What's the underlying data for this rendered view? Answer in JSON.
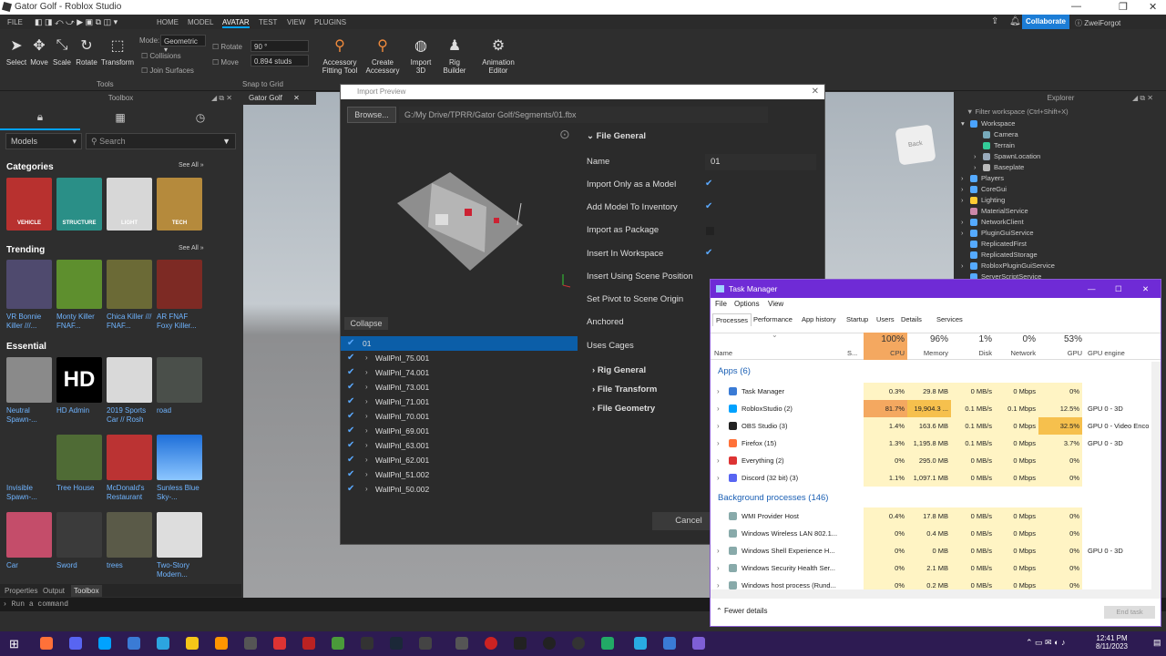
{
  "window": {
    "title": "Gator Golf - Roblox Studio"
  },
  "menubar": {
    "items": [
      "FILE",
      "HOME",
      "MODEL",
      "AVATAR",
      "TEST",
      "VIEW",
      "PLUGINS"
    ],
    "active": "AVATAR",
    "collaborate": "Collaborate",
    "user": "ZweiForgot"
  },
  "ribbon": {
    "tools": [
      "Select",
      "Move",
      "Scale",
      "Rotate",
      "Transform"
    ],
    "tools_group": "Tools",
    "mode_label": "Mode:",
    "mode_value": "Geometric",
    "collisions": "Collisions",
    "join_surfaces": "Join Surfaces",
    "rotate_label": "Rotate",
    "rotate_value": "90 °",
    "move_label": "Move",
    "move_value": "0.894 studs",
    "snap_group": "Snap to Grid",
    "avatar_tools": [
      {
        "label1": "Accessory",
        "label2": "Fitting Tool"
      },
      {
        "label1": "Create",
        "label2": "Accessory"
      },
      {
        "label1": "Import",
        "label2": "3D"
      },
      {
        "label1": "Rig",
        "label2": "Builder"
      },
      {
        "label1": "Animation",
        "label2": "Editor"
      }
    ]
  },
  "toolbox": {
    "title": "Toolbox",
    "filter": "Models",
    "search_placeholder": "Search",
    "categories_title": "Categories",
    "see_all": "See All »",
    "categories": [
      "VEHICLE",
      "STRUCTURE",
      "LIGHT",
      "TECH"
    ],
    "trending_title": "Trending",
    "trending": [
      "VR Bonnie Killer ///...",
      "Monty Killer FNAF...",
      "Chica Killer /// FNAF...",
      "AR FNAF Foxy Killer..."
    ],
    "essential_title": "Essential",
    "essential": [
      "Neutral Spawn-...",
      "HD Admin",
      "2019 Sports Car // Rosh",
      "road",
      "Invisible Spawn-...",
      "Tree House",
      "McDonald's Restaurant",
      "Sunless Blue Sky-...",
      "Car",
      "Sword",
      "trees",
      "Two-Story Modern..."
    ],
    "hd_badge": "HD"
  },
  "bottom_tabs": [
    "Properties",
    "Output",
    "Toolbox"
  ],
  "command_placeholder": "Run a command",
  "viewport": {
    "tab": "Gator Golf",
    "cube_label": "Back"
  },
  "import": {
    "title": "Import Preview",
    "browse": "Browse...",
    "path": "G:/My Drive/TPRR/Gator Golf/Segments/01.fbx",
    "collapse": "Collapse",
    "tree_root": "01",
    "tree_items": [
      "WallPnl_75.001",
      "WallPnl_74.001",
      "WallPnl_73.001",
      "WallPnl_71.001",
      "WallPnl_70.001",
      "WallPnl_69.001",
      "WallPnl_63.001",
      "WallPnl_62.001",
      "WallPnl_51.002",
      "WallPnl_50.002"
    ],
    "section_general": "File General",
    "name_label": "Name",
    "name_value": "01",
    "props": [
      {
        "label": "Import Only as a Model",
        "checked": true
      },
      {
        "label": "Add Model To Inventory",
        "checked": true
      },
      {
        "label": "Import as Package",
        "checked": false
      },
      {
        "label": "Insert In Workspace",
        "checked": true
      },
      {
        "label": "Insert Using Scene Position",
        "checked": false
      },
      {
        "label": "Set Pivot to Scene Origin",
        "checked": false
      },
      {
        "label": "Anchored",
        "checked": false
      },
      {
        "label": "Uses Cages",
        "checked": false
      }
    ],
    "sections": [
      "Rig General",
      "File Transform",
      "File Geometry"
    ],
    "cancel": "Cancel"
  },
  "explorer": {
    "title": "Explorer",
    "filter": "Filter workspace (Ctrl+Shift+X)",
    "items": [
      {
        "name": "Workspace",
        "indent": 0,
        "color": "#4aa3ff",
        "arrow": "▾"
      },
      {
        "name": "Camera",
        "indent": 1,
        "color": "#7ab",
        "arrow": ""
      },
      {
        "name": "Terrain",
        "indent": 1,
        "color": "#3c9",
        "arrow": ""
      },
      {
        "name": "SpawnLocation",
        "indent": 1,
        "color": "#9ab",
        "arrow": "›"
      },
      {
        "name": "Baseplate",
        "indent": 1,
        "color": "#bbb",
        "arrow": "›"
      },
      {
        "name": "Players",
        "indent": 0,
        "color": "#5af",
        "arrow": "›"
      },
      {
        "name": "CoreGui",
        "indent": 0,
        "color": "#5af",
        "arrow": "›"
      },
      {
        "name": "Lighting",
        "indent": 0,
        "color": "#fc3",
        "arrow": "›"
      },
      {
        "name": "MaterialService",
        "indent": 0,
        "color": "#c8a",
        "arrow": ""
      },
      {
        "name": "NetworkClient",
        "indent": 0,
        "color": "#5af",
        "arrow": "›"
      },
      {
        "name": "PluginGuiService",
        "indent": 0,
        "color": "#5af",
        "arrow": "›"
      },
      {
        "name": "ReplicatedFirst",
        "indent": 0,
        "color": "#5af",
        "arrow": ""
      },
      {
        "name": "ReplicatedStorage",
        "indent": 0,
        "color": "#5af",
        "arrow": ""
      },
      {
        "name": "RobloxPluginGuiService",
        "indent": 0,
        "color": "#5af",
        "arrow": "›"
      },
      {
        "name": "ServerScriptService",
        "indent": 0,
        "color": "#5af",
        "arrow": ""
      }
    ]
  },
  "taskmgr": {
    "title": "Task Manager",
    "menu": [
      "File",
      "Options",
      "View"
    ],
    "tabs": [
      "Processes",
      "Performance",
      "App history",
      "Startup",
      "Users",
      "Details",
      "Services"
    ],
    "columns": {
      "name": "Name",
      "status": "S...",
      "cpu_pct": "100%",
      "cpu": "CPU",
      "mem_pct": "96%",
      "mem": "Memory",
      "disk_pct": "1%",
      "disk": "Disk",
      "net_pct": "0%",
      "net": "Network",
      "gpu_pct": "53%",
      "gpu": "GPU",
      "gpu_engine": "GPU engine"
    },
    "apps_title": "Apps (6)",
    "apps": [
      {
        "name": "Task Manager",
        "cpu": "0.3%",
        "mem": "29.8 MB",
        "disk": "0 MB/s",
        "net": "0 Mbps",
        "gpu": "0%",
        "engine": "",
        "icon": "#3a7bd5"
      },
      {
        "name": "RobloxStudio (2)",
        "cpu": "81.7%",
        "mem": "19,904.3 ...",
        "disk": "0.1 MB/s",
        "net": "0.1 Mbps",
        "gpu": "12.5%",
        "engine": "GPU 0 - 3D",
        "icon": "#00a2ff"
      },
      {
        "name": "OBS Studio (3)",
        "cpu": "1.4%",
        "mem": "163.6 MB",
        "disk": "0.1 MB/s",
        "net": "0 Mbps",
        "gpu": "32.5%",
        "engine": "GPU 0 - Video Enco",
        "icon": "#222"
      },
      {
        "name": "Firefox (15)",
        "cpu": "1.3%",
        "mem": "1,195.8 MB",
        "disk": "0.1 MB/s",
        "net": "0 Mbps",
        "gpu": "3.7%",
        "engine": "GPU 0 - 3D",
        "icon": "#ff7139"
      },
      {
        "name": "Everything (2)",
        "cpu": "0%",
        "mem": "295.0 MB",
        "disk": "0 MB/s",
        "net": "0 Mbps",
        "gpu": "0%",
        "engine": "",
        "icon": "#d33"
      },
      {
        "name": "Discord (32 bit) (3)",
        "cpu": "1.1%",
        "mem": "1,097.1 MB",
        "disk": "0 MB/s",
        "net": "0 Mbps",
        "gpu": "0%",
        "engine": "",
        "icon": "#5865f2"
      }
    ],
    "bg_title": "Background processes (146)",
    "bg": [
      {
        "name": "WMI Provider Host",
        "cpu": "0.4%",
        "mem": "17.8 MB",
        "disk": "0 MB/s",
        "net": "0 Mbps",
        "gpu": "0%",
        "engine": "",
        "exp": false
      },
      {
        "name": "Windows Wireless LAN 802.1...",
        "cpu": "0%",
        "mem": "0.4 MB",
        "disk": "0 MB/s",
        "net": "0 Mbps",
        "gpu": "0%",
        "engine": "",
        "exp": false
      },
      {
        "name": "Windows Shell Experience H...",
        "cpu": "0%",
        "mem": "0 MB",
        "disk": "0 MB/s",
        "net": "0 Mbps",
        "gpu": "0%",
        "engine": "GPU 0 - 3D",
        "exp": true
      },
      {
        "name": "Windows Security Health Ser...",
        "cpu": "0%",
        "mem": "2.1 MB",
        "disk": "0 MB/s",
        "net": "0 Mbps",
        "gpu": "0%",
        "engine": "",
        "exp": true
      },
      {
        "name": "Windows host process (Rund...",
        "cpu": "0%",
        "mem": "0.2 MB",
        "disk": "0 MB/s",
        "net": "0 Mbps",
        "gpu": "0%",
        "engine": "",
        "exp": true
      }
    ],
    "fewer": "Fewer details",
    "end_task": "End task"
  },
  "taskbar": {
    "time": "12:41 PM",
    "date": "8/11/2023"
  }
}
